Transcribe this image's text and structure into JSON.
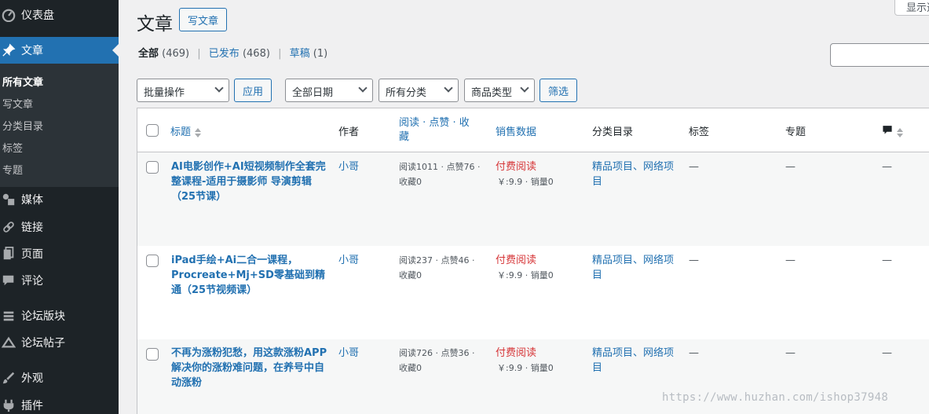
{
  "sidebar": {
    "items": [
      {
        "label": "仪表盘",
        "icon": "dashboard-icon"
      },
      {
        "label": "文章",
        "icon": "pin-icon",
        "active": true
      },
      {
        "label": "媒体",
        "icon": "media-icon"
      },
      {
        "label": "链接",
        "icon": "link-icon"
      },
      {
        "label": "页面",
        "icon": "pages-icon"
      },
      {
        "label": "评论",
        "icon": "comment-icon"
      },
      {
        "label": "论坛版块",
        "icon": "forum-icon"
      },
      {
        "label": "论坛帖子",
        "icon": "topic-icon"
      },
      {
        "label": "外观",
        "icon": "brush-icon"
      },
      {
        "label": "插件",
        "icon": "plugin-icon"
      }
    ],
    "submenu": [
      "所有文章",
      "写文章",
      "分类目录",
      "标签",
      "专题"
    ]
  },
  "header": {
    "title": "文章",
    "add_new": "写文章",
    "screen_options": "显示选项"
  },
  "filters": {
    "views": [
      {
        "label": "全部",
        "count": "(469)"
      },
      {
        "label": "已发布",
        "count": "(468)"
      },
      {
        "label": "草稿",
        "count": "(1)"
      }
    ],
    "bulk_action": "批量操作",
    "apply": "应用",
    "date": "全部日期",
    "category": "所有分类",
    "product_type": "商品类型",
    "filter": "筛选"
  },
  "table": {
    "columns": {
      "title": "标题",
      "author": "作者",
      "stats": "阅读 · 点赞 · 收藏",
      "sales": "销售数据",
      "categories": "分类目录",
      "tags": "标签",
      "topics": "专题"
    },
    "rows": [
      {
        "title": "AI电影创作+AI短视频制作全套完整课程-适用于摄影师 导演剪辑（25节课）",
        "author": "小哥",
        "stats": "阅读1011 · 点赞76 · 收藏0",
        "paid": "付费阅读",
        "price": "￥:9.9 · 销量0",
        "categories": "精品项目、网络项目",
        "tags": "—",
        "topics": "—",
        "comments": "—"
      },
      {
        "title": "iPad手绘+Ai二合一课程，Procreate+Mj+SD零基础到精通（25节视频课）",
        "author": "小哥",
        "stats": "阅读237 · 点赞46 · 收藏0",
        "paid": "付费阅读",
        "price": "￥:9.9 · 销量0",
        "categories": "精品项目、网络项目",
        "tags": "—",
        "topics": "—",
        "comments": "—"
      },
      {
        "title": "不再为涨粉犯愁，用这款涨粉APP解决你的涨粉难问题，在养号中自动涨粉",
        "author": "小哥",
        "stats": "阅读726 · 点赞36 · 收藏0",
        "paid": "付费阅读",
        "price": "￥:9.9 · 销量0",
        "categories": "精品项目、网络项目",
        "tags": "—",
        "topics": "—",
        "comments": "—"
      }
    ]
  },
  "watermark": "https://www.huzhan.com/ishop37948",
  "colors": {
    "accent": "#2271b1",
    "sidebar": "#1d2327",
    "paid": "#d63638"
  }
}
